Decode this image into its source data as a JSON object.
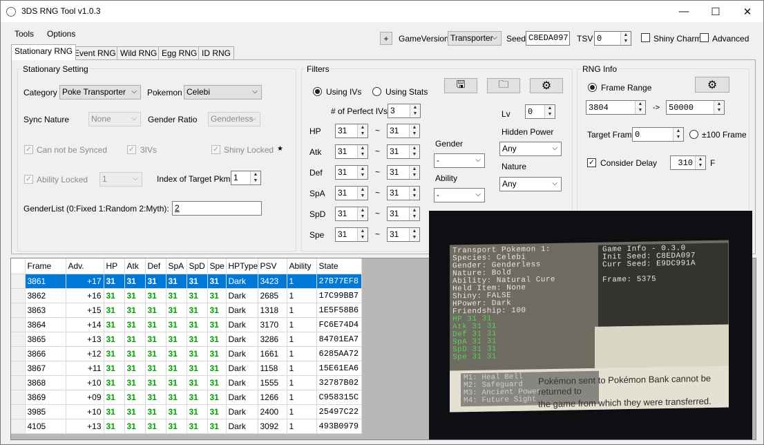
{
  "window": {
    "title": "3DS RNG Tool v1.0.3",
    "minimize": "—",
    "maximize": "☐",
    "close": "✕"
  },
  "menu": {
    "tools": "Tools",
    "options": "Options"
  },
  "toolbar": {
    "plus_label": "+",
    "game_version_label": "GameVersion",
    "game_version_value": "Transporter",
    "seed_label": "Seed",
    "seed_value": "C8EDA097",
    "tsv_label": "TSV",
    "tsv_value": "0",
    "shiny_charm_label": "Shiny Charm",
    "advanced_label": "Advanced"
  },
  "tabs": [
    "Stationary RNG",
    "Event RNG",
    "Wild RNG",
    "Egg RNG",
    "ID RNG"
  ],
  "stationary": {
    "title": "Stationary Setting",
    "category_label": "Category",
    "category_value": "Poke Transporter",
    "pokemon_label": "Pokemon",
    "pokemon_value": "Celebi",
    "sync_nature_label": "Sync Nature",
    "sync_nature_value": "None",
    "gender_ratio_label": "Gender Ratio",
    "gender_ratio_value": "Genderless",
    "cannot_sync_label": "Can not be Synced",
    "threeivs_label": "3IVs",
    "shiny_locked_label": "Shiny Locked",
    "star": "★",
    "ability_locked_label": "Ability Locked",
    "ability_value": "1",
    "index_target_label": "Index of Target Pkm",
    "index_target_value": "1",
    "genderlist_label": "GenderList (0:Fixed 1:Random 2:Myth):",
    "genderlist_value": "2"
  },
  "filters": {
    "title": "Filters",
    "using_ivs": "Using IVs",
    "using_stats": "Using Stats",
    "perfect_ivs_label": "# of Perfect IVs",
    "perfect_ivs_value": "3",
    "stats": [
      {
        "label": "HP",
        "min": "31",
        "max": "31"
      },
      {
        "label": "Atk",
        "min": "31",
        "max": "31"
      },
      {
        "label": "Def",
        "min": "31",
        "max": "31"
      },
      {
        "label": "SpA",
        "min": "31",
        "max": "31"
      },
      {
        "label": "SpD",
        "min": "31",
        "max": "31"
      },
      {
        "label": "Spe",
        "min": "31",
        "max": "31"
      }
    ],
    "tilde": "~",
    "gender_label": "Gender",
    "gender_value": "-",
    "ability_label": "Ability",
    "ability_value": "-",
    "lv_label": "Lv",
    "lv_value": "0",
    "hidden_power_label": "Hidden Power",
    "hidden_power_value": "Any",
    "nature_label": "Nature",
    "nature_value": "Any"
  },
  "rnginfo": {
    "title": "RNG Info",
    "frame_range_label": "Frame Range",
    "frame_start": "3804",
    "arrow": "->",
    "frame_end": "50000",
    "target_frame_label": "Target Frame",
    "target_frame_value": "0",
    "plus100_label": "±100 Frame",
    "consider_delay_label": "Consider Delay",
    "delay_value": "310",
    "delay_unit": "F"
  },
  "grid": {
    "columns": [
      "Frame",
      "Adv.",
      "HP",
      "Atk",
      "Def",
      "SpA",
      "SpD",
      "Spe",
      "HPType",
      "PSV",
      "Ability",
      "State"
    ],
    "rows": [
      [
        "3861",
        "+17",
        "31",
        "31",
        "31",
        "31",
        "31",
        "31",
        "Dark",
        "3423",
        "1",
        "27B77EF8"
      ],
      [
        "3862",
        "+16",
        "31",
        "31",
        "31",
        "31",
        "31",
        "31",
        "Dark",
        "2685",
        "1",
        "17C99BB7"
      ],
      [
        "3863",
        "+15",
        "31",
        "31",
        "31",
        "31",
        "31",
        "31",
        "Dark",
        "1318",
        "1",
        "1E5F58B6"
      ],
      [
        "3864",
        "+14",
        "31",
        "31",
        "31",
        "31",
        "31",
        "31",
        "Dark",
        "3170",
        "1",
        "FC6E74D4"
      ],
      [
        "3865",
        "+13",
        "31",
        "31",
        "31",
        "31",
        "31",
        "31",
        "Dark",
        "3286",
        "1",
        "84701EA7"
      ],
      [
        "3866",
        "+12",
        "31",
        "31",
        "31",
        "31",
        "31",
        "31",
        "Dark",
        "1661",
        "1",
        "6285AA72"
      ],
      [
        "3867",
        "+11",
        "31",
        "31",
        "31",
        "31",
        "31",
        "31",
        "Dark",
        "1158",
        "1",
        "15E61EA6"
      ],
      [
        "3868",
        "+10",
        "31",
        "31",
        "31",
        "31",
        "31",
        "31",
        "Dark",
        "1555",
        "1",
        "32787B02"
      ],
      [
        "3869",
        "+09",
        "31",
        "31",
        "31",
        "31",
        "31",
        "31",
        "Dark",
        "1266",
        "1",
        "C958315C"
      ],
      [
        "3985",
        "+10",
        "31",
        "31",
        "31",
        "31",
        "31",
        "31",
        "Dark",
        "2400",
        "1",
        "25497C22"
      ],
      [
        "4105",
        "+13",
        "31",
        "31",
        "31",
        "31",
        "31",
        "31",
        "Dark",
        "3092",
        "1",
        "493B0979"
      ]
    ]
  },
  "photo": {
    "left_lines": [
      "Transport Pokemon 1:",
      "Species: Celebi",
      "Gender: Genderless",
      "Nature: Bold",
      "Ability: Natural Cure",
      "Held Item: None",
      "Shiny: FALSE",
      "HPower: Dark",
      "Friendship: 100"
    ],
    "iv_lines": [
      "HP   31  31",
      "Atk  31  31",
      "Def  31  31",
      "SpA  31  31",
      "SpD  31  31",
      "Spe  31  31"
    ],
    "right_lines": [
      "Game Info - 0.3.0",
      "Init Seed: C8EDA097",
      "Curr Seed: E9DC991A",
      "",
      "Frame: 5375"
    ],
    "moves": [
      "M1: Heal Bell",
      "M2: Safeguard",
      "M3: Ancient Power",
      "M4: Future Sight"
    ],
    "bottom_text_1": "Pokémon sent to Pokémon Bank cannot be returned to",
    "bottom_text_2": "the game from which they were transferred."
  }
}
